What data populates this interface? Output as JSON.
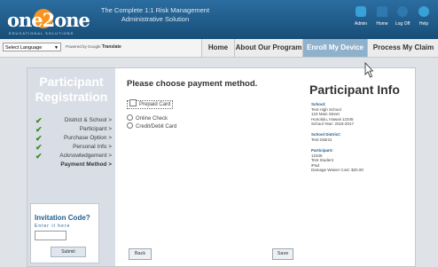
{
  "header": {
    "logo_text": "one2one",
    "logo_tagline": "EDUCATIONAL SOLUTIONS",
    "tagline_line1": "The Complete 1:1 Risk Management",
    "tagline_line2": "Administrative Solution",
    "icons": [
      {
        "label": "Admin",
        "icon": "admin-icon",
        "color": "#3aa0d8"
      },
      {
        "label": "Home",
        "icon": "home-icon",
        "color": "#2f78b0"
      },
      {
        "label": "Log Off",
        "icon": "log-off-icon",
        "color": "#2f78b0"
      },
      {
        "label": "Help",
        "icon": "help-icon",
        "color": "#3aa0d8"
      }
    ]
  },
  "toolbar": {
    "language_select": "Select Language",
    "powered_by": "Powered by",
    "google": "Google",
    "translate": "Translate"
  },
  "nav": {
    "tabs": [
      "Home",
      "About Our Program",
      "Enroll My Device",
      "Process My Claim"
    ],
    "active": "Enroll My Device"
  },
  "registration": {
    "title_line1": "Participant",
    "title_line2": "Registration",
    "steps": [
      {
        "label": "District & School >",
        "done": true
      },
      {
        "label": "Participant >",
        "done": true
      },
      {
        "label": "Purchase Option >",
        "done": true
      },
      {
        "label": "Personal Info >",
        "done": true
      },
      {
        "label": "Acknowledgement >",
        "done": true
      },
      {
        "label": "Payment Method >",
        "done": false
      }
    ]
  },
  "invitation": {
    "title": "Invitation Code?",
    "subtitle": "Enter it here",
    "submit": "Submit"
  },
  "payment": {
    "title": "Please choose payment method.",
    "options": [
      "Prepaid Card",
      "Online Check",
      "Credit/Debit Card"
    ],
    "back": "Back",
    "save": "Save"
  },
  "participant_info": {
    "title": "Participant Info",
    "school_heading": "School:",
    "school_lines": [
      "Test High School",
      "123 Main Street",
      "Honolulu, Hawaii 12345",
      "School Year: 2016-2017"
    ],
    "district_heading": "School District:",
    "district_lines": [
      "Test District"
    ],
    "participant_heading": "Participant:",
    "participant_lines": [
      "12345",
      "Test Student",
      "iPad",
      "Damage Waiver Cost: $20.00"
    ]
  },
  "colors": {
    "header": "#1f5d8c",
    "accent": "#f7931e",
    "active_tab": "#8fb1cc",
    "check": "#3a8a1e"
  }
}
